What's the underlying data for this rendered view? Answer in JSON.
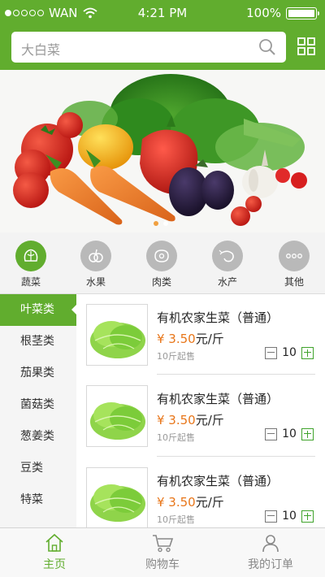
{
  "status_bar": {
    "carrier": "WAN",
    "time": "4:21 PM",
    "battery": "100%"
  },
  "search": {
    "placeholder": "大白菜"
  },
  "categories": [
    {
      "label": "蔬菜",
      "icon": "lettuce-icon",
      "active": true
    },
    {
      "label": "水果",
      "icon": "fruit-icon",
      "active": false
    },
    {
      "label": "肉类",
      "icon": "meat-icon",
      "active": false
    },
    {
      "label": "水产",
      "icon": "shrimp-icon",
      "active": false
    },
    {
      "label": "其他",
      "icon": "more-icon",
      "active": false
    }
  ],
  "sidebar": {
    "items": [
      {
        "label": "叶菜类",
        "active": true
      },
      {
        "label": "根茎类"
      },
      {
        "label": "茄果类"
      },
      {
        "label": "菌菇类"
      },
      {
        "label": "葱姜类"
      },
      {
        "label": "豆类"
      },
      {
        "label": "特菜"
      }
    ]
  },
  "products": [
    {
      "name": "有机农家生菜（普通）",
      "price": "¥ 3.50",
      "unit": "元/斤",
      "moq": "10斤起售",
      "qty": "10"
    },
    {
      "name": "有机农家生菜（普通）",
      "price": "¥ 3.50",
      "unit": "元/斤",
      "moq": "10斤起售",
      "qty": "10"
    },
    {
      "name": "有机农家生菜（普通）",
      "price": "¥ 3.50",
      "unit": "元/斤",
      "moq": "10斤起售",
      "qty": "10"
    }
  ],
  "tabbar": {
    "items": [
      {
        "label": "主页",
        "icon": "home-icon",
        "active": true
      },
      {
        "label": "购物车",
        "icon": "cart-icon"
      },
      {
        "label": "我的订单",
        "icon": "profile-icon"
      }
    ]
  },
  "colors": {
    "accent": "#61ad2e",
    "price": "#e8761a"
  }
}
